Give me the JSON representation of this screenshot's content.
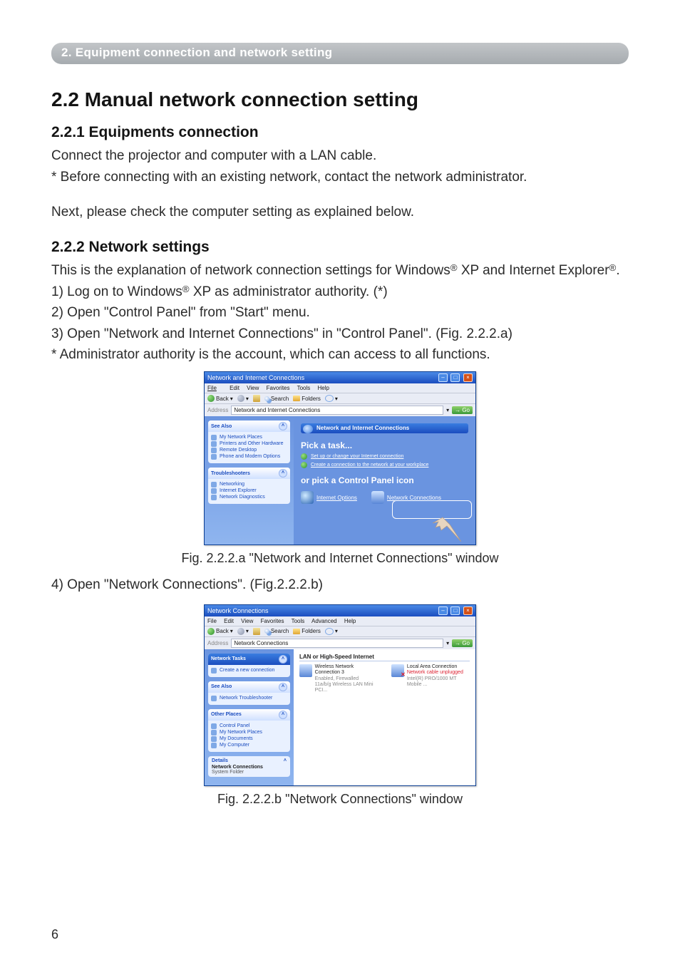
{
  "breadcrumb": "2. Equipment connection and network setting",
  "section_title": "2.2 Manual network connection setting",
  "sub1_title": "2.2.1 Equipments connection",
  "sub1_p1": "Connect the projector and computer with a LAN cable.",
  "sub1_p2": "* Before connecting with an existing network, contact the network administrator.",
  "sub1_p3": "Next, please check the computer setting as explained below.",
  "sub2_title": "2.2.2 Network settings",
  "sub2_intro_a": "This is the explanation of network connection settings for Windows",
  "sub2_intro_b": " XP and Internet Explorer",
  "sub2_intro_c": ".",
  "step1_a": "1) Log on to Windows",
  "step1_b": " XP as administrator authority. (*)",
  "step2": "2) Open \"Control Panel\" from \"Start\" menu.",
  "step3": "3) Open \"Network and Internet Connections\" in \"Control Panel\". (Fig. 2.2.2.a)",
  "step_note": "* Administrator authority is the account, which can access to all functions.",
  "fig_a_caption": "Fig. 2.2.2.a \"Network and Internet Connections\" window",
  "step4": "4) Open \"Network Connections\". (Fig.2.2.2.b)",
  "fig_b_caption": "Fig. 2.2.2.b \"Network Connections\" window",
  "page_number": "6",
  "reg_mark": "®",
  "winA": {
    "title": "Network and Internet Connections",
    "menus": {
      "file": "File",
      "edit": "Edit",
      "view": "View",
      "favorites": "Favorites",
      "tools": "Tools",
      "help": "Help"
    },
    "toolbar": {
      "back": "Back",
      "search": "Search",
      "folders": "Folders"
    },
    "address_label": "Address",
    "address_value": "Network and Internet Connections",
    "go": "Go",
    "side_see_also": {
      "title": "See Also",
      "items": [
        "My Network Places",
        "Printers and Other Hardware",
        "Remote Desktop",
        "Phone and Modem Options"
      ]
    },
    "side_trouble": {
      "title": "Troubleshooters",
      "items": [
        "Networking",
        "Internet Explorer",
        "Network Diagnostics"
      ]
    },
    "banner": "Network and Internet Connections",
    "pick_task": "Pick a task...",
    "task1": "Set up or change your Internet connection",
    "task2": "Create a connection to the network at your workplace",
    "or_pick": "or pick a Control Panel icon",
    "icon_internet_options": "Internet Options",
    "icon_network_connections": "Network Connections"
  },
  "winB": {
    "title": "Network Connections",
    "menus": {
      "file": "File",
      "edit": "Edit",
      "view": "View",
      "favorites": "Favorites",
      "tools": "Tools",
      "advanced": "Advanced",
      "help": "Help"
    },
    "toolbar": {
      "back": "Back",
      "search": "Search",
      "folders": "Folders"
    },
    "address_label": "Address",
    "address_value": "Network Connections",
    "go": "Go",
    "side_tasks": {
      "title": "Network Tasks",
      "items": [
        "Create a new connection"
      ]
    },
    "side_see_also": {
      "title": "See Also",
      "items": [
        "Network Troubleshooter"
      ]
    },
    "side_other": {
      "title": "Other Places",
      "items": [
        "Control Panel",
        "My Network Places",
        "My Documents",
        "My Computer"
      ]
    },
    "side_details": {
      "title": "Details",
      "name": "Network Connections",
      "type": "System Folder"
    },
    "group": "LAN or High-Speed Internet",
    "conn1": {
      "name": "Wireless Network Connection 3",
      "status": "Enabled, Firewalled",
      "device": "11a/b/g Wireless LAN Mini PCI..."
    },
    "conn2": {
      "name": "Local Area Connection",
      "status": "Network cable unplugged",
      "device": "Intel(R) PRO/1000 MT Mobile ..."
    }
  }
}
